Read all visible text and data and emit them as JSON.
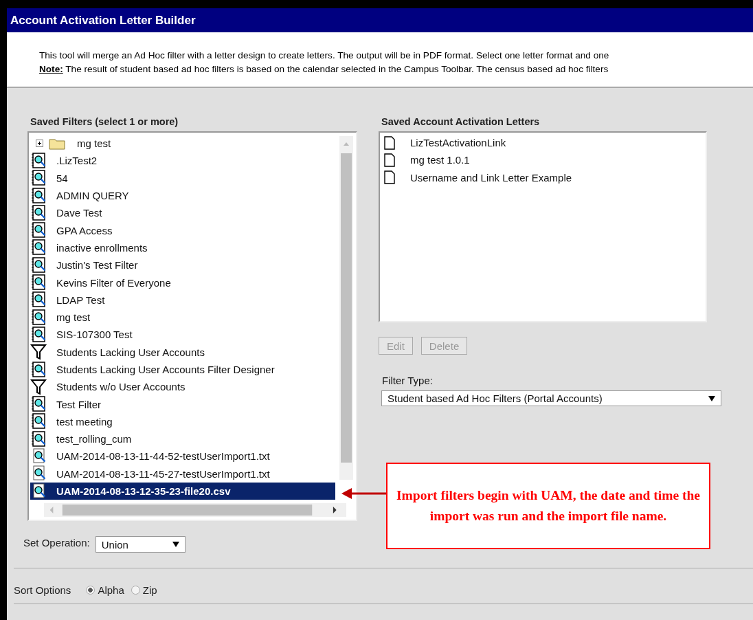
{
  "window": {
    "title": "Account Activation Letter Builder"
  },
  "description": [
    "This tool will merge an Ad Hoc filter with a letter design to create letters. The output will be in PDF format. Select one letter format and one",
    "**Note:** The result of student based ad hoc filters is based on the calendar selected in the Campus Toolbar. The census based ad hoc filters"
  ],
  "saved_filters": {
    "heading": "Saved Filters (select 1 or more)",
    "folder": {
      "label": "mg test",
      "expanded": false
    },
    "items": [
      {
        "label": ".LizTest2",
        "kind": "query",
        "selected": false
      },
      {
        "label": "54",
        "kind": "query",
        "selected": false
      },
      {
        "label": "ADMIN QUERY",
        "kind": "query",
        "selected": false
      },
      {
        "label": "Dave Test",
        "kind": "query",
        "selected": false
      },
      {
        "label": "GPA Access",
        "kind": "query",
        "selected": false
      },
      {
        "label": "inactive enrollments",
        "kind": "query",
        "selected": false
      },
      {
        "label": "Justin's Test Filter",
        "kind": "query",
        "selected": false
      },
      {
        "label": "Kevins Filter of Everyone",
        "kind": "query",
        "selected": false
      },
      {
        "label": "LDAP Test",
        "kind": "query",
        "selected": false
      },
      {
        "label": "mg test",
        "kind": "query",
        "selected": false
      },
      {
        "label": "SIS-107300 Test",
        "kind": "query",
        "selected": false
      },
      {
        "label": "Students Lacking User Accounts",
        "kind": "funnel",
        "selected": false
      },
      {
        "label": "Students Lacking User Accounts Filter Designer",
        "kind": "query",
        "selected": false
      },
      {
        "label": "Students w/o User Accounts",
        "kind": "funnel",
        "selected": false
      },
      {
        "label": "Test Filter",
        "kind": "query",
        "selected": false
      },
      {
        "label": "test meeting",
        "kind": "query",
        "selected": false
      },
      {
        "label": "test_rolling_cum",
        "kind": "query",
        "selected": false
      },
      {
        "label": "UAM-2014-08-13-11-44-52-testUserImport1.txt",
        "kind": "import",
        "selected": false
      },
      {
        "label": "UAM-2014-08-13-11-45-27-testUserImport1.txt",
        "kind": "import",
        "selected": false
      },
      {
        "label": "UAM-2014-08-13-12-35-23-file20.csv",
        "kind": "import",
        "selected": true
      }
    ]
  },
  "set_operation": {
    "label": "Set Operation:",
    "value": "Union"
  },
  "saved_letters": {
    "heading": "Saved Account Activation Letters",
    "items": [
      {
        "label": "LizTestActivationLink"
      },
      {
        "label": "mg test 1.0.1"
      },
      {
        "label": "Username and Link Letter Example"
      }
    ]
  },
  "buttons": [
    {
      "label": "Edit",
      "disabled": true
    },
    {
      "label": "Delete",
      "disabled": true
    }
  ],
  "filter_type": {
    "label": "Filter Type:",
    "value": "Student based Ad Hoc Filters (Portal Accounts)"
  },
  "callout": {
    "text": "Import filters begin with UAM, the date and time the import was run and the import file name."
  },
  "sort_options": {
    "label": "Sort Options",
    "options": [
      {
        "label": "Alpha",
        "selected": true
      },
      {
        "label": "Zip",
        "selected": false
      }
    ]
  }
}
